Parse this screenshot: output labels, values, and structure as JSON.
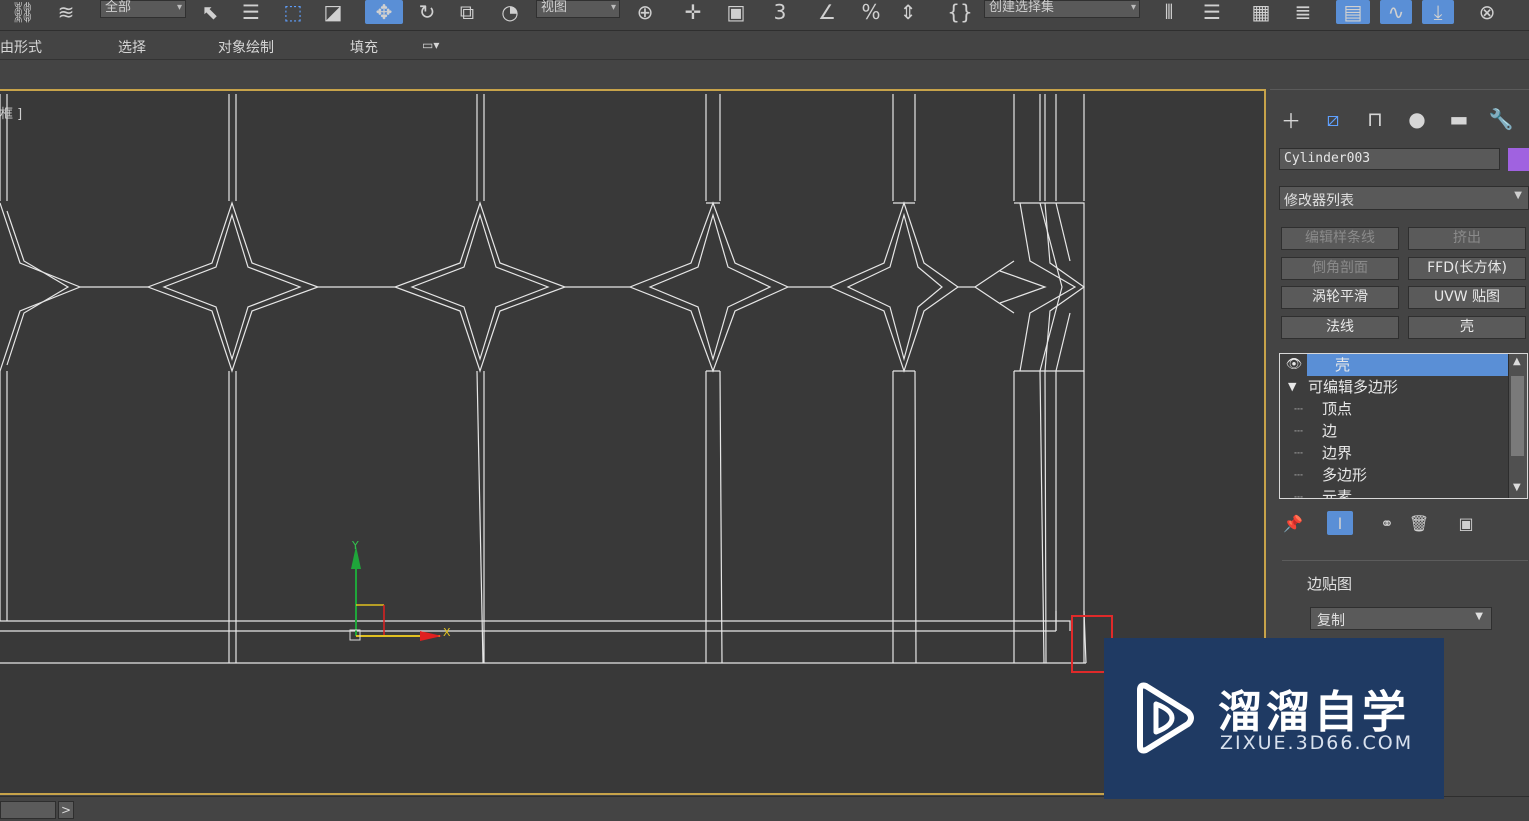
{
  "toolbar": {
    "filter_dropdown": "全部",
    "coord_dropdown": "视图",
    "snap_label": "3",
    "percent_label": "%",
    "selection_set_dropdown": "创建选择集"
  },
  "ribbon": {
    "tabs": [
      "由形式",
      "选择",
      "对象绘制",
      "填充"
    ]
  },
  "viewport": {
    "label": "框 ]",
    "axis_y": "Y",
    "axis_x": "X",
    "wire_color": "#e6e6e6",
    "border_color": "#c7a34a"
  },
  "command_panel": {
    "object_name": "Cylinder003",
    "object_color": "#a062e0",
    "modifier_list": "修改器列表",
    "modifier_buttons": [
      "编辑样条线",
      "挤出",
      "倒角剖面",
      "FFD(长方体)",
      "涡轮平滑",
      "UVW 贴图",
      "法线",
      "壳"
    ],
    "stack": {
      "selected": "壳",
      "parent": "可编辑多边形",
      "children": [
        "顶点",
        "边",
        "边界",
        "多边形",
        "元素"
      ]
    },
    "rollout_title": "边贴图",
    "edge_map_value": "复制"
  },
  "watermark": {
    "title": "溜溜自学",
    "subtitle": "ZIXUE.3D66.COM"
  }
}
